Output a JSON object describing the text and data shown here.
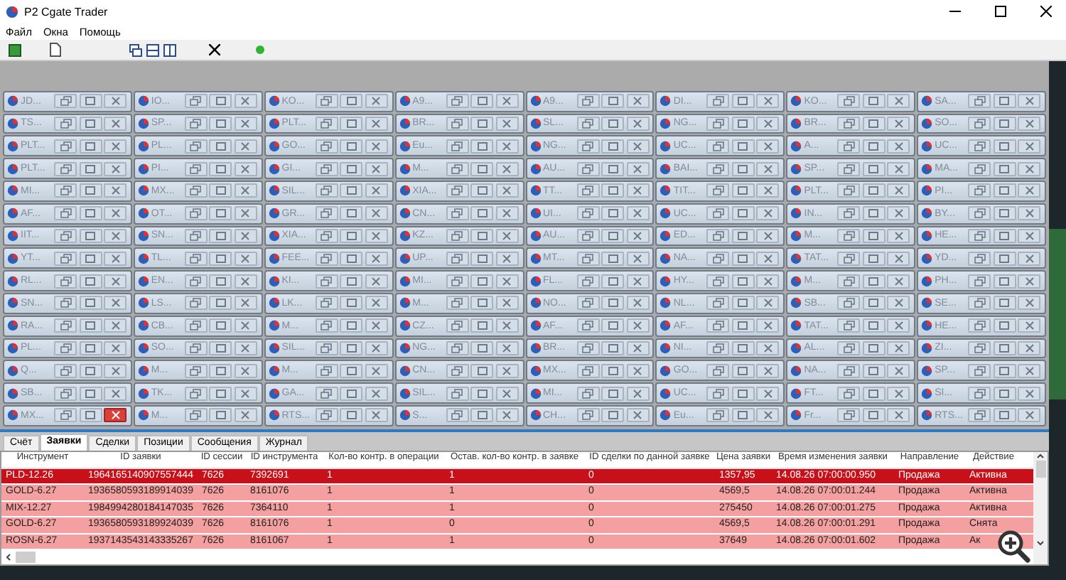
{
  "window": {
    "title": "P2 Cgate Trader"
  },
  "menu": [
    "Файл",
    "Окна",
    "Помощь"
  ],
  "mdi_windows": [
    {
      "title": "JD...",
      "close_hover": false
    },
    {
      "title": "IO...",
      "close_hover": false
    },
    {
      "title": "KO...",
      "close_hover": false
    },
    {
      "title": "A9...",
      "close_hover": false
    },
    {
      "title": "A9...",
      "close_hover": false
    },
    {
      "title": "DI...",
      "close_hover": false
    },
    {
      "title": "KO...",
      "close_hover": false
    },
    {
      "title": "SA...",
      "close_hover": false
    },
    {
      "title": "TS...",
      "close_hover": false
    },
    {
      "title": "SP...",
      "close_hover": false
    },
    {
      "title": "PLT...",
      "close_hover": false
    },
    {
      "title": "BR...",
      "close_hover": false
    },
    {
      "title": "SL...",
      "close_hover": false
    },
    {
      "title": "NG...",
      "close_hover": false
    },
    {
      "title": "BR...",
      "close_hover": false
    },
    {
      "title": "SO...",
      "close_hover": false
    },
    {
      "title": "PLT...",
      "close_hover": false
    },
    {
      "title": "PL...",
      "close_hover": false
    },
    {
      "title": "GO...",
      "close_hover": false
    },
    {
      "title": "Eu...",
      "close_hover": false
    },
    {
      "title": "NG...",
      "close_hover": false
    },
    {
      "title": "UC...",
      "close_hover": false
    },
    {
      "title": "A...",
      "close_hover": false
    },
    {
      "title": "UC...",
      "close_hover": false
    },
    {
      "title": "PLT...",
      "close_hover": false
    },
    {
      "title": "PI...",
      "close_hover": false
    },
    {
      "title": "GI...",
      "close_hover": false
    },
    {
      "title": "M...",
      "close_hover": false
    },
    {
      "title": "AU...",
      "close_hover": false
    },
    {
      "title": "BAI...",
      "close_hover": false
    },
    {
      "title": "SP...",
      "close_hover": false
    },
    {
      "title": "MA...",
      "close_hover": false
    },
    {
      "title": "MI...",
      "close_hover": false
    },
    {
      "title": "MX...",
      "close_hover": false
    },
    {
      "title": "SIL...",
      "close_hover": false
    },
    {
      "title": "XIA...",
      "close_hover": false
    },
    {
      "title": "TT...",
      "close_hover": false
    },
    {
      "title": "TIT...",
      "close_hover": false
    },
    {
      "title": "PLT...",
      "close_hover": false
    },
    {
      "title": "PI...",
      "close_hover": false
    },
    {
      "title": "AF...",
      "close_hover": false
    },
    {
      "title": "OT...",
      "close_hover": false
    },
    {
      "title": "GR...",
      "close_hover": false
    },
    {
      "title": "CN...",
      "close_hover": false
    },
    {
      "title": "UI...",
      "close_hover": false
    },
    {
      "title": "UC...",
      "close_hover": false
    },
    {
      "title": "IN...",
      "close_hover": false
    },
    {
      "title": "BY...",
      "close_hover": false
    },
    {
      "title": "IIT...",
      "close_hover": false
    },
    {
      "title": "SN...",
      "close_hover": false
    },
    {
      "title": "XIA...",
      "close_hover": false
    },
    {
      "title": "KZ...",
      "close_hover": false
    },
    {
      "title": "AU...",
      "close_hover": false
    },
    {
      "title": "ED...",
      "close_hover": false
    },
    {
      "title": "M...",
      "close_hover": false
    },
    {
      "title": "HE...",
      "close_hover": false
    },
    {
      "title": "YT...",
      "close_hover": false
    },
    {
      "title": "TL...",
      "close_hover": false
    },
    {
      "title": "FEE...",
      "close_hover": false
    },
    {
      "title": "UP...",
      "close_hover": false
    },
    {
      "title": "MT...",
      "close_hover": false
    },
    {
      "title": "NA...",
      "close_hover": false
    },
    {
      "title": "TAT...",
      "close_hover": false
    },
    {
      "title": "YD...",
      "close_hover": false
    },
    {
      "title": "RL...",
      "close_hover": false
    },
    {
      "title": "EN...",
      "close_hover": false
    },
    {
      "title": "KI...",
      "close_hover": false
    },
    {
      "title": "MI...",
      "close_hover": false
    },
    {
      "title": "FL...",
      "close_hover": false
    },
    {
      "title": "HY...",
      "close_hover": false
    },
    {
      "title": "M...",
      "close_hover": false
    },
    {
      "title": "PH...",
      "close_hover": false
    },
    {
      "title": "SN...",
      "close_hover": false
    },
    {
      "title": "LS...",
      "close_hover": false
    },
    {
      "title": "LK...",
      "close_hover": false
    },
    {
      "title": "M...",
      "close_hover": false
    },
    {
      "title": "NO...",
      "close_hover": false
    },
    {
      "title": "NL...",
      "close_hover": false
    },
    {
      "title": "SB...",
      "close_hover": false
    },
    {
      "title": "SE...",
      "close_hover": false
    },
    {
      "title": "RA...",
      "close_hover": false
    },
    {
      "title": "CB...",
      "close_hover": false
    },
    {
      "title": "M...",
      "close_hover": false
    },
    {
      "title": "CZ...",
      "close_hover": false
    },
    {
      "title": "AF...",
      "close_hover": false
    },
    {
      "title": "AF...",
      "close_hover": false
    },
    {
      "title": "TAT...",
      "close_hover": false
    },
    {
      "title": "HE...",
      "close_hover": false
    },
    {
      "title": "PL...",
      "close_hover": false
    },
    {
      "title": "SO...",
      "close_hover": false
    },
    {
      "title": "SIL...",
      "close_hover": false
    },
    {
      "title": "NG...",
      "close_hover": false
    },
    {
      "title": "BR...",
      "close_hover": false
    },
    {
      "title": "NI...",
      "close_hover": false
    },
    {
      "title": "AL...",
      "close_hover": false
    },
    {
      "title": "ZI...",
      "close_hover": false
    },
    {
      "title": "Q...",
      "close_hover": false
    },
    {
      "title": "M...",
      "close_hover": false
    },
    {
      "title": "M...",
      "close_hover": false
    },
    {
      "title": "CN...",
      "close_hover": false
    },
    {
      "title": "MX...",
      "close_hover": false
    },
    {
      "title": "GO...",
      "close_hover": false
    },
    {
      "title": "NA...",
      "close_hover": false
    },
    {
      "title": "SP...",
      "close_hover": false
    },
    {
      "title": "SB...",
      "close_hover": false
    },
    {
      "title": "TK...",
      "close_hover": false
    },
    {
      "title": "GA...",
      "close_hover": false
    },
    {
      "title": "SIL...",
      "close_hover": false
    },
    {
      "title": "MI...",
      "close_hover": false
    },
    {
      "title": "UC...",
      "close_hover": false
    },
    {
      "title": "FT...",
      "close_hover": false
    },
    {
      "title": "SI...",
      "close_hover": false
    },
    {
      "title": "MX...",
      "close_hover": true
    },
    {
      "title": "M...",
      "close_hover": false
    },
    {
      "title": "RTS...",
      "close_hover": false
    },
    {
      "title": "S...",
      "close_hover": false
    },
    {
      "title": "CH...",
      "close_hover": false
    },
    {
      "title": "Eu...",
      "close_hover": false
    },
    {
      "title": "Fr...",
      "close_hover": false
    },
    {
      "title": "RTS...",
      "close_hover": false
    }
  ],
  "tabs": [
    {
      "label": "Счёт",
      "selected": false
    },
    {
      "label": "Заявки",
      "selected": true
    },
    {
      "label": "Сделки",
      "selected": false
    },
    {
      "label": "Позиции",
      "selected": false
    },
    {
      "label": "Сообщения",
      "selected": false
    },
    {
      "label": "Журнал",
      "selected": false
    }
  ],
  "table": {
    "columns": [
      "Инструмент",
      "ID заявки",
      "ID сессии",
      "ID инструмента",
      "Кол-во контр. в операции",
      "Остав. кол-во контр. в заявке",
      "ID сделки по данной заявке",
      "Цена заявки",
      "Время изменения заявки",
      "Направление",
      "Действие"
    ],
    "rows": [
      {
        "selected": true,
        "cells": [
          "PLD-12.26",
          "1964165140907557444",
          "7626",
          "7392691",
          "1",
          "1",
          "0",
          "1357,95",
          "14.08.26 07:00:00.950",
          "Продажа",
          "Активна"
        ]
      },
      {
        "selected": false,
        "cells": [
          "GOLD-6.27",
          "1936580593189914039",
          "7626",
          "8161076",
          "1",
          "1",
          "0",
          "4569,5",
          "14.08.26 07:00:01.244",
          "Продажа",
          "Активна"
        ]
      },
      {
        "selected": false,
        "cells": [
          "MIX-12.27",
          "1984994280184147035",
          "7626",
          "7364110",
          "1",
          "1",
          "0",
          "275450",
          "14.08.26 07:00:01.275",
          "Продажа",
          "Активна"
        ]
      },
      {
        "selected": false,
        "cells": [
          "GOLD-6.27",
          "1936580593189924039",
          "7626",
          "8161076",
          "1",
          "0",
          "0",
          "4569,5",
          "14.08.26 07:00:01.291",
          "Продажа",
          "Снята"
        ]
      },
      {
        "selected": false,
        "cells": [
          "ROSN-6.27",
          "1937143543143335267",
          "7626",
          "8161067",
          "1",
          "1",
          "0",
          "37649",
          "14.08.26 07:00:01.602",
          "Продажа",
          "Ак"
        ]
      }
    ]
  }
}
